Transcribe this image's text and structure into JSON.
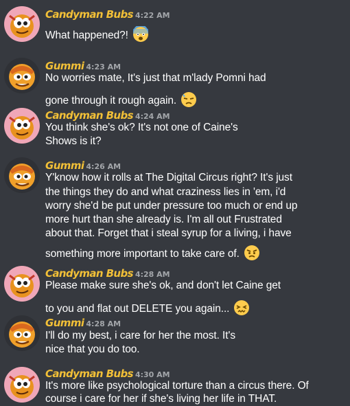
{
  "messages": [
    {
      "author": "Candyman Bubs",
      "time": "4:22 AM",
      "avatar": "candyman-bubs",
      "lines": [
        "What happened?!"
      ],
      "emoji": "fearful-face"
    },
    {
      "author": "Gummi",
      "time": "4:23 AM",
      "avatar": "gummi",
      "lines": [
        "No worries mate, It's just that m'lady Pomni had",
        "gone through it rough again."
      ],
      "emoji": "downcast-sweat-face"
    },
    {
      "author": "Candyman Bubs",
      "time": "4:24 AM",
      "avatar": "candyman-bubs",
      "lines": [
        "You think she's ok? It's not one of Caine's",
        "Shows is it?"
      ]
    },
    {
      "author": "Gummi",
      "time": "4:26 AM",
      "avatar": "gummi",
      "lines": [
        "Y'know how it rolls at The Digital Circus right? It's just",
        "the things they do and what craziness lies in 'em, i'd",
        "worry she'd be put under pressure too much or end up",
        "more hurt than she already is. I'm all out Frustrated",
        "about that. Forget that i steal syrup for a living, i have",
        "something more important to take care of."
      ],
      "emoji": "angry-face"
    },
    {
      "author": "Candyman Bubs",
      "time": "4:28 AM",
      "avatar": "candyman-bubs",
      "lines": [
        "Please make sure she's ok, and don't let Caine get",
        "to you and flat out DELETE you again..."
      ],
      "emoji": "confounded-face"
    },
    {
      "author": "Gummi",
      "time": "4:28 AM",
      "avatar": "gummi",
      "lines": [
        "I'll do my best, i care for her the most. It's",
        "nice that you do too."
      ]
    },
    {
      "author": "Candyman Bubs",
      "time": "4:30 AM",
      "avatar": "candyman-bubs",
      "lines": [
        "It's more like psychological torture than a circus there. Of",
        "course i care for her if she's living her life in THAT."
      ]
    }
  ]
}
